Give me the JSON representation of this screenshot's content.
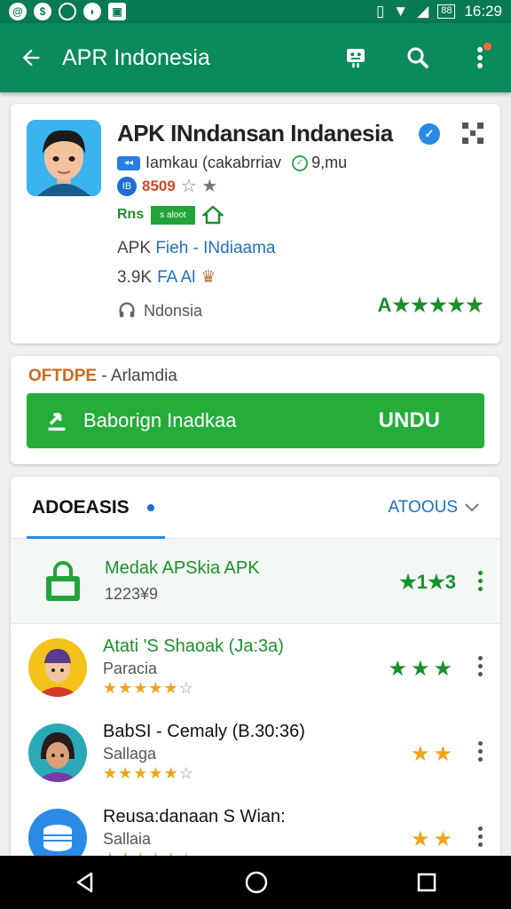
{
  "status_bar": {
    "time": "16:29",
    "battery": "88"
  },
  "app_bar": {
    "title": "APR Indonesia"
  },
  "app": {
    "title": "APK INndansan Indanesia",
    "developer": "Iamkau (cakabrriav",
    "version": "9,mu",
    "rating": "8509",
    "badge_label": "Rns",
    "badge_text": "s aloot",
    "subtitle_prefix": "APK",
    "subtitle_link": "Fieh - INdiaama",
    "downloads": "3.9K",
    "downloads_link": "FA Al",
    "region": "Ndonsia",
    "rating_stars": "A★★★★★"
  },
  "download_section": {
    "label_prefix": "OFTDPE",
    "label_text": "- Arlamdia",
    "button_label": "Baborign Inadkaa",
    "button_action": "UNDU"
  },
  "list_section": {
    "title": "ADOEASIS",
    "sort_label": "ATOOUS",
    "featured": {
      "title": "Medak APSkia APK",
      "sub": "1223¥9",
      "rating": "★1★3"
    },
    "items": [
      {
        "title": "Atati 'S Shaoak (Ja:3a)",
        "sub": "Paracia",
        "stars": "★★★★★",
        "off_star": "☆",
        "right_stars": "★★★",
        "right_color": "#1c8f2d"
      },
      {
        "title": "BabSI - Cemaly (B.30:36)",
        "sub": "Sallaga",
        "stars": "★★★★★",
        "off_star": "☆",
        "right_stars": "★★",
        "right_color": "#f0a41a"
      },
      {
        "title": "Reusa:danaan S Wian:",
        "sub": "Sallaia",
        "stars": "★★★★★",
        "off_star": "☆",
        "right_stars": "★★",
        "right_color": "#f0a41a"
      }
    ]
  },
  "colors": {
    "primary": "#0b8a5c",
    "accent_green": "#25ad3a",
    "link_blue": "#1f6fc4",
    "star_orange": "#f0a41a"
  }
}
